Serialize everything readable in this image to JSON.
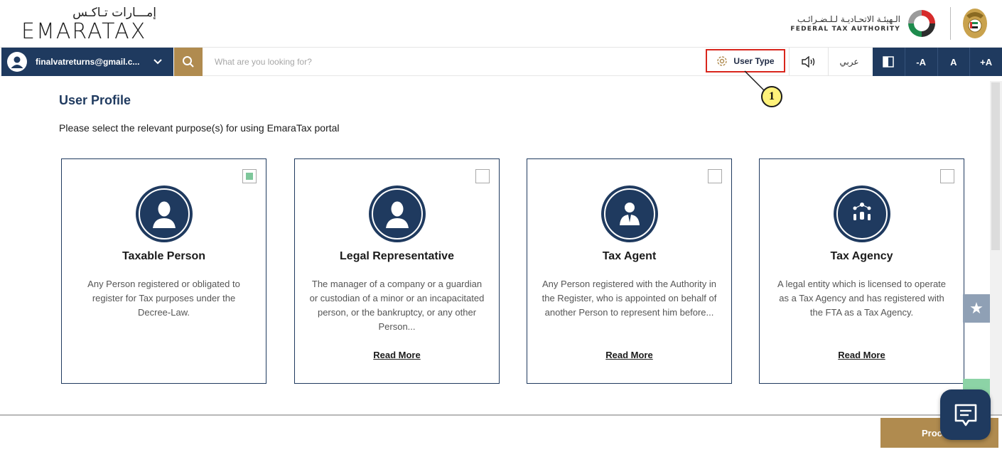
{
  "header": {
    "logo_arabic": "إمـــارات تـاكـس",
    "logo_latin": "EMARATAX",
    "authority_arabic": "الـهيئـة الاتحـاديـة لـلـضـرائـب",
    "authority_english": "FEDERAL TAX AUTHORITY"
  },
  "toolbar": {
    "account_email": "finalvatreturns@gmail.c...",
    "search_placeholder": "What are you looking for?",
    "user_type_label": "User Type",
    "language_label": "عربي",
    "font_decrease": "-A",
    "font_normal": "A",
    "font_increase": "+A"
  },
  "callout": {
    "number": "1"
  },
  "page": {
    "title": "User Profile",
    "subtitle": "Please select the relevant purpose(s) for using EmaraTax portal"
  },
  "cards": [
    {
      "title": "Taxable Person",
      "description": "Any Person registered or obligated to register for Tax purposes under the Decree-Law.",
      "read_more": "",
      "checked": true,
      "icon": "person-icon"
    },
    {
      "title": "Legal Representative",
      "description": "The manager of a company or a guardian or custodian of a minor or an incapacitated person, or the bankruptcy, or any other Person...",
      "read_more": "Read More",
      "checked": false,
      "icon": "person-icon"
    },
    {
      "title": "Tax Agent",
      "description": "Any Person registered with the Authority in the Register, who is appointed on behalf of another Person to represent him before...",
      "read_more": "Read More",
      "checked": false,
      "icon": "agent-icon"
    },
    {
      "title": "Tax Agency",
      "description": "A legal entity which is licensed to operate as a Tax Agency and has registered with the FTA as a Tax Agency.",
      "read_more": "Read More",
      "checked": false,
      "icon": "agency-network-icon"
    }
  ],
  "footer": {
    "proceed_label": "Proc"
  },
  "colors": {
    "navy": "#1f3a5f",
    "gold": "#b08b4f",
    "highlight_red": "#d9261c",
    "callout_yellow": "#fff27a",
    "check_green": "#7ec79b"
  }
}
